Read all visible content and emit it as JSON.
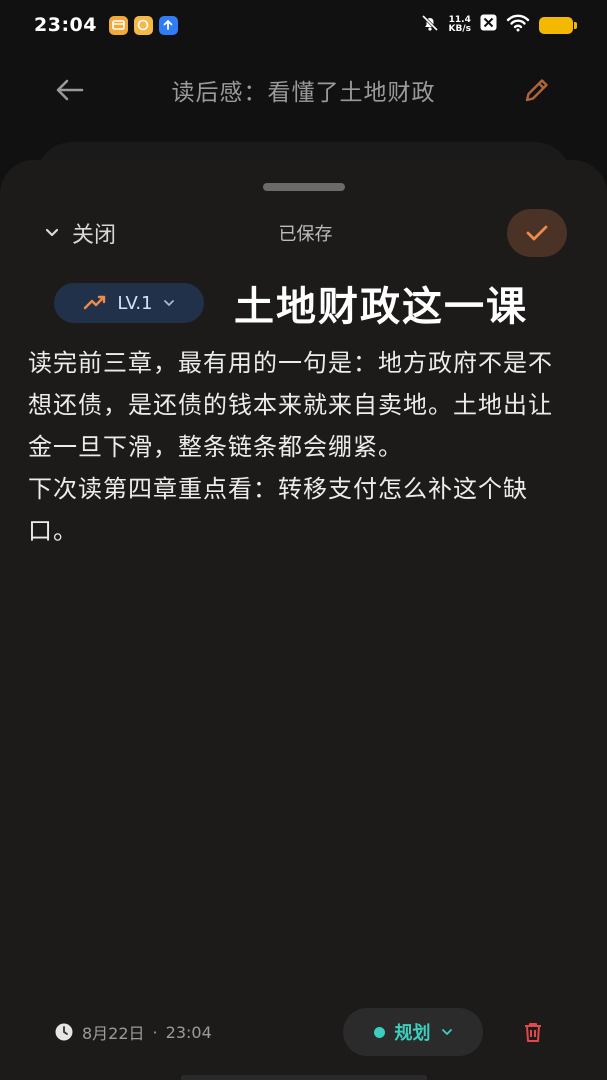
{
  "status_bar": {
    "time": "23:04",
    "net_speed_value": "11.4",
    "net_speed_unit": "KB/s",
    "icons": [
      "notification-app-icon",
      "notification-app-icon",
      "upload-app-icon",
      "mute-bell-icon",
      "x-icon",
      "wifi-icon",
      "battery-icon"
    ]
  },
  "header": {
    "title": "读后感：看懂了土地财政"
  },
  "sheet": {
    "close_label": "关闭",
    "saved_label": "已保存",
    "level_label": "LV.1",
    "note_title": "土地财政这一课",
    "body_paragraphs": [
      "读完前三章，最有用的一句是：地方政府不是不想还债，是还债的钱本来就来自卖地。土地出让金一旦下滑，整条链条都会绷紧。",
      "下次读第四章重点看：转移支付怎么补这个缺口。"
    ]
  },
  "bottom_bar": {
    "date": "8月22日",
    "separator": "·",
    "time": "23:04",
    "category_label": "规划"
  },
  "colors": {
    "accent_orange": "#f08a4b",
    "teal": "#3ccfc0",
    "delete_red": "#e0484a",
    "level_chip_bg": "#22314a"
  }
}
